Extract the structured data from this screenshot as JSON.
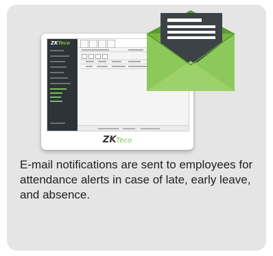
{
  "card": {
    "message": "E-mail notifications are sent to employees for attendance alerts in case of late, early leave, and absence."
  },
  "monitor": {
    "brand_main": "ZK",
    "brand_accent": "Teco"
  },
  "icons": {
    "envelope": "envelope-icon",
    "letter": "letter-icon",
    "monitor": "monitor-icon"
  },
  "colors": {
    "card_bg": "#e5e5e5",
    "envelope_green": "#76b843",
    "envelope_dark_green": "#5a9a2e",
    "letter_dark": "#3d4247",
    "sidebar": "#2e3338"
  }
}
